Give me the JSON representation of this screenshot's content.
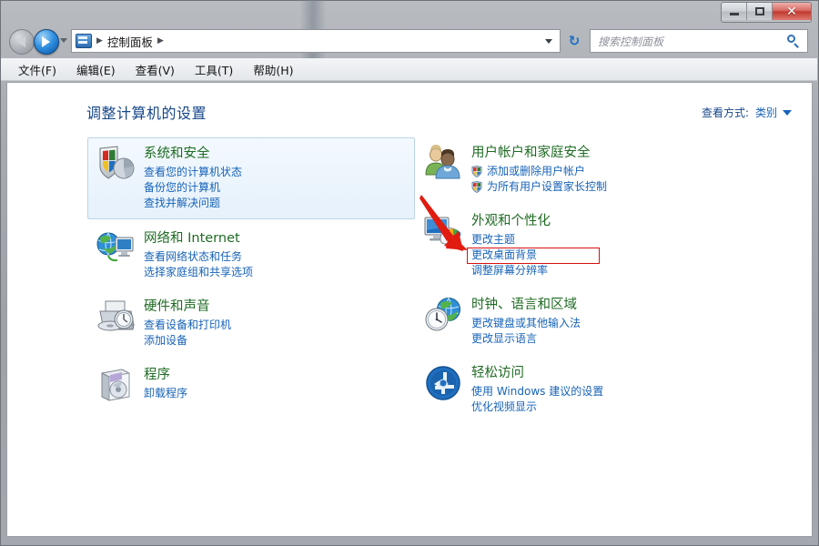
{
  "window": {
    "controls": {
      "minimize_label": "–",
      "maximize_label": "□",
      "close_label": "✕"
    }
  },
  "nav": {
    "back_tooltip": "后退",
    "forward_tooltip": "前进",
    "address_icon": "control-panel-icon",
    "breadcrumb": [
      "控制面板"
    ],
    "refresh_label": "↻"
  },
  "search": {
    "placeholder": "搜索控制面板",
    "value": ""
  },
  "menu": {
    "items": [
      {
        "label": "文件(F)"
      },
      {
        "label": "编辑(E)"
      },
      {
        "label": "查看(V)"
      },
      {
        "label": "工具(T)"
      },
      {
        "label": "帮助(H)"
      }
    ]
  },
  "main": {
    "title": "调整计算机的设置",
    "view_by": {
      "label": "查看方式:",
      "value": "类别"
    }
  },
  "categories_left": [
    {
      "title": "系统和安全",
      "icon": "shield-chart-icon",
      "highlighted": true,
      "links": [
        {
          "label": "查看您的计算机状态",
          "shield": false
        },
        {
          "label": "备份您的计算机",
          "shield": false
        },
        {
          "label": "查找并解决问题",
          "shield": false
        }
      ]
    },
    {
      "title": "网络和 Internet",
      "icon": "globe-network-icon",
      "highlighted": false,
      "links": [
        {
          "label": "查看网络状态和任务",
          "shield": false
        },
        {
          "label": "选择家庭组和共享选项",
          "shield": false
        }
      ]
    },
    {
      "title": "硬件和声音",
      "icon": "printer-devices-icon",
      "highlighted": false,
      "links": [
        {
          "label": "查看设备和打印机",
          "shield": false
        },
        {
          "label": "添加设备",
          "shield": false
        }
      ]
    },
    {
      "title": "程序",
      "icon": "programs-box-icon",
      "highlighted": false,
      "links": [
        {
          "label": "卸载程序",
          "shield": false
        }
      ]
    }
  ],
  "categories_right": [
    {
      "title": "用户帐户和家庭安全",
      "icon": "users-icon",
      "highlighted": false,
      "links": [
        {
          "label": "添加或删除用户帐户",
          "shield": true,
          "annotated": true
        },
        {
          "label": "为所有用户设置家长控制",
          "shield": true
        }
      ]
    },
    {
      "title": "外观和个性化",
      "icon": "monitor-palette-icon",
      "highlighted": false,
      "links": [
        {
          "label": "更改主题",
          "shield": false
        },
        {
          "label": "更改桌面背景",
          "shield": false
        },
        {
          "label": "调整屏幕分辨率",
          "shield": false
        }
      ]
    },
    {
      "title": "时钟、语言和区域",
      "icon": "clock-globe-icon",
      "highlighted": false,
      "links": [
        {
          "label": "更改键盘或其他输入法",
          "shield": false
        },
        {
          "label": "更改显示语言",
          "shield": false
        }
      ]
    },
    {
      "title": "轻松访问",
      "icon": "ease-of-access-icon",
      "highlighted": false,
      "links": [
        {
          "label": "使用 Windows 建议的设置",
          "shield": false
        },
        {
          "label": "优化视频显示",
          "shield": false
        }
      ]
    }
  ],
  "annotation": {
    "arrow_color": "#e01b10",
    "rect_color": "#d81010",
    "target_link": "添加或删除用户帐户"
  }
}
